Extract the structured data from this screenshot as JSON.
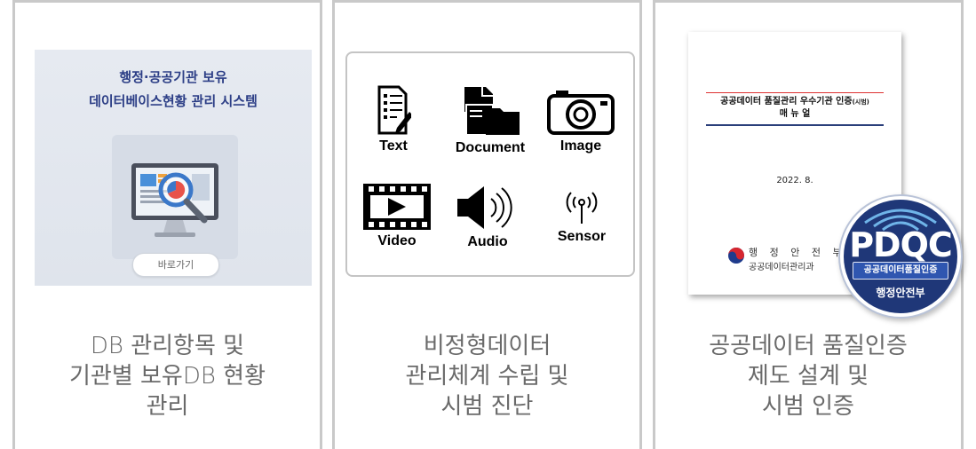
{
  "cards": [
    {
      "caption": [
        "DB 관리항목 및",
        "기관별 보유DB 현황",
        "관리"
      ],
      "thumb": {
        "title_lines": [
          "행정·공공기관 보유",
          "데이터베이스현황 관리 시스템"
        ],
        "button_label": "바로가기"
      }
    },
    {
      "caption": [
        "비정형데이터",
        "관리체계 수립 및",
        "시범 진단"
      ],
      "data_types": [
        {
          "label": "Text",
          "icon": "text-document-icon"
        },
        {
          "label": "Document",
          "icon": "documents-folder-icon"
        },
        {
          "label": "Image",
          "icon": "camera-icon"
        },
        {
          "label": "Video",
          "icon": "video-film-icon"
        },
        {
          "label": "Audio",
          "icon": "speaker-icon"
        },
        {
          "label": "Sensor",
          "icon": "antenna-signal-icon"
        }
      ]
    },
    {
      "caption": [
        "공공데이터 품질인증",
        "제도 설계 및",
        "시범 인증"
      ],
      "document": {
        "title_line1": "공공데이터 품질관리 우수기관 인증",
        "title_suffix": "(시범)",
        "title_line2": "매 뉴 얼",
        "date": "2022. 8.",
        "ministry": "행 정 안 전 부",
        "department": "공공데이터관리과"
      },
      "seal": {
        "letters": "PDQC",
        "band_text": "공공데이터품질인증",
        "bottom_text": "행정안전부"
      }
    }
  ],
  "colors": {
    "caption": "#6a6a6a",
    "border": "#c9c9c9",
    "db_title": "#2c3e86",
    "seal": "#1f3778"
  }
}
